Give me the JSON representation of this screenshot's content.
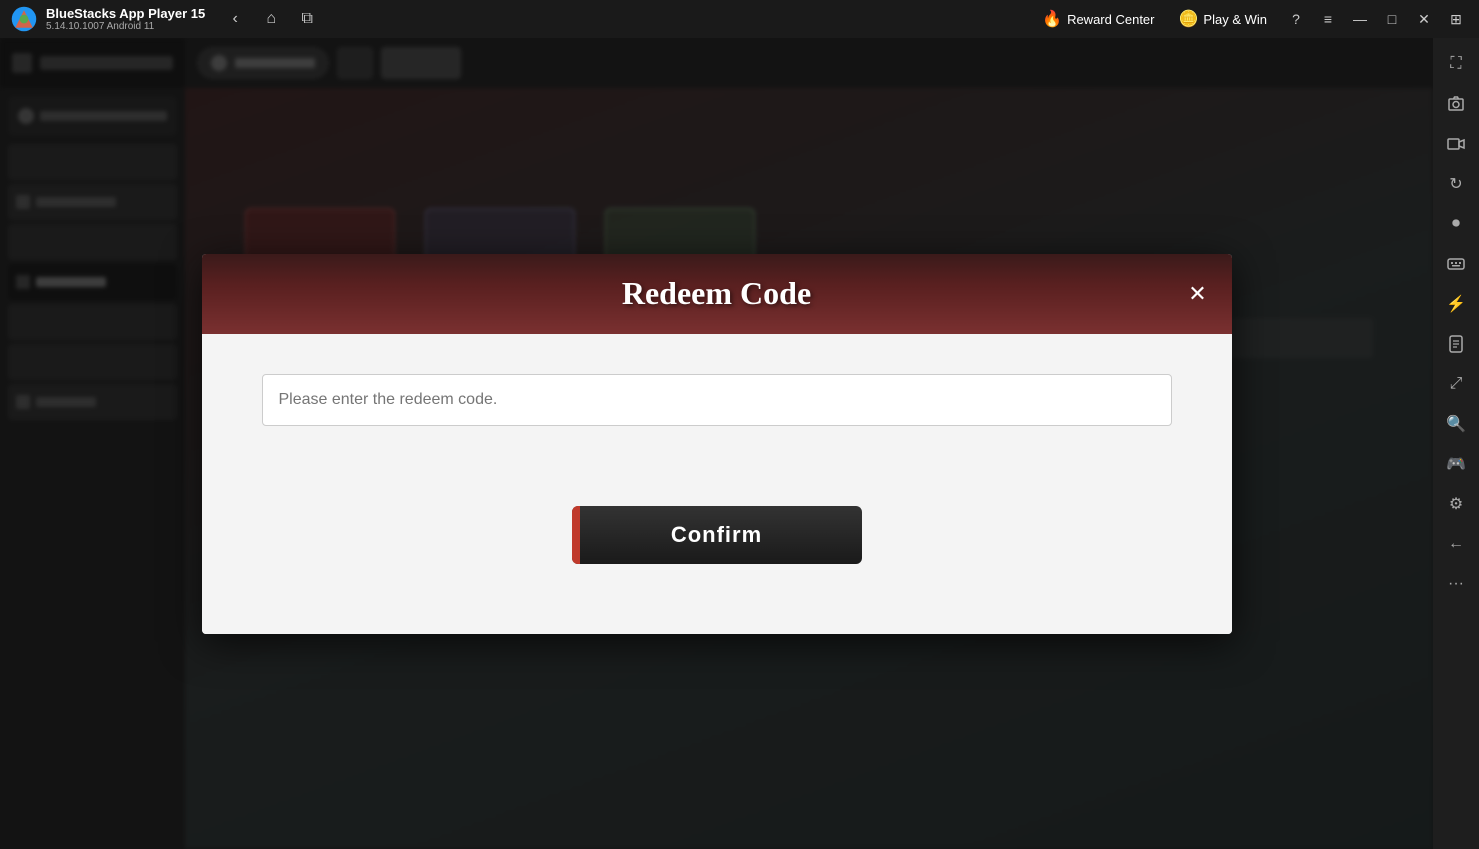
{
  "titleBar": {
    "appName": "BlueStacks App Player 15",
    "appVersion": "5.14.10.1007  Android 11",
    "rewardCenter": {
      "label": "Reward Center",
      "icon": "🔥"
    },
    "playAndWin": {
      "label": "Play & Win",
      "icon": "🪙"
    },
    "buttons": {
      "help": "?",
      "menu": "≡",
      "minimize": "—",
      "maximize": "□",
      "close": "✕",
      "restore": "❐"
    }
  },
  "rightSidebar": {
    "icons": [
      {
        "name": "expand-icon",
        "symbol": "⛶"
      },
      {
        "name": "screenshot-icon",
        "symbol": "📷"
      },
      {
        "name": "camera-icon",
        "symbol": "🎥"
      },
      {
        "name": "rotate-icon",
        "symbol": "↻"
      },
      {
        "name": "record-icon",
        "symbol": "⏺"
      },
      {
        "name": "keymap-icon",
        "symbol": "⌨"
      },
      {
        "name": "macro-icon",
        "symbol": "⚡"
      },
      {
        "name": "script-icon",
        "symbol": "📝"
      },
      {
        "name": "scale-icon",
        "symbol": "⤢"
      },
      {
        "name": "zoom-icon",
        "symbol": "🔍"
      },
      {
        "name": "gamepad-icon",
        "symbol": "🎮"
      },
      {
        "name": "settings-icon",
        "symbol": "⚙"
      },
      {
        "name": "arrow-icon",
        "symbol": "←"
      },
      {
        "name": "more-icon",
        "symbol": "···"
      }
    ]
  },
  "modal": {
    "title": "Redeem Code",
    "closeButton": "✕",
    "input": {
      "placeholder": "Please enter the redeem code."
    },
    "confirmButton": "Confirm"
  }
}
